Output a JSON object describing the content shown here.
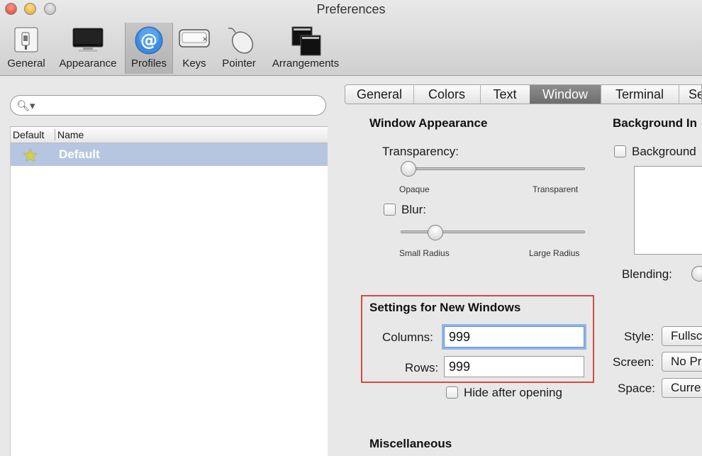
{
  "window": {
    "title": "Preferences"
  },
  "toolbar": {
    "items": [
      {
        "label": "General",
        "icon": "switch-icon"
      },
      {
        "label": "Appearance",
        "icon": "monitor-icon"
      },
      {
        "label": "Profiles",
        "icon": "at-sign-icon",
        "selected": true
      },
      {
        "label": "Keys",
        "icon": "keyboard-key-icon"
      },
      {
        "label": "Pointer",
        "icon": "mouse-icon"
      },
      {
        "label": "Arrangements",
        "icon": "windows-stack-icon"
      }
    ]
  },
  "profiles": {
    "search_placeholder": "",
    "columns": [
      "Default",
      "Name"
    ],
    "rows": [
      {
        "default_icon": "star-icon",
        "name": "Default",
        "selected": true
      }
    ]
  },
  "tabs": [
    {
      "label": "General"
    },
    {
      "label": "Colors"
    },
    {
      "label": "Text"
    },
    {
      "label": "Window",
      "active": true
    },
    {
      "label": "Terminal"
    },
    {
      "label": "Se"
    }
  ],
  "window_appearance": {
    "heading": "Window Appearance",
    "transparency_label": "Transparency:",
    "transparency_min": "Opaque",
    "transparency_max": "Transparent",
    "transparency_value": 0.0,
    "blur_label": "Blur:",
    "blur_checked": false,
    "blur_min": "Small Radius",
    "blur_max": "Large Radius",
    "blur_value": 0.16
  },
  "new_windows": {
    "heading": "Settings for New Windows",
    "columns_label": "Columns:",
    "columns_value": "999",
    "rows_label": "Rows:",
    "rows_value": "999",
    "hide_label": "Hide after opening",
    "hide_checked": false
  },
  "misc": {
    "heading": "Miscellaneous"
  },
  "background": {
    "heading": "Background In",
    "image_label": "Background",
    "blending_label": "Blending:",
    "style_label": "Style:",
    "style_value": "Fullsc",
    "screen_label": "Screen:",
    "screen_value": "No Pr",
    "space_label": "Space:",
    "space_value": "Curre"
  },
  "colors": {
    "accent": "#8fb5e8",
    "selection": "#b7c6e0",
    "highlight_box": "#d64a3f"
  }
}
